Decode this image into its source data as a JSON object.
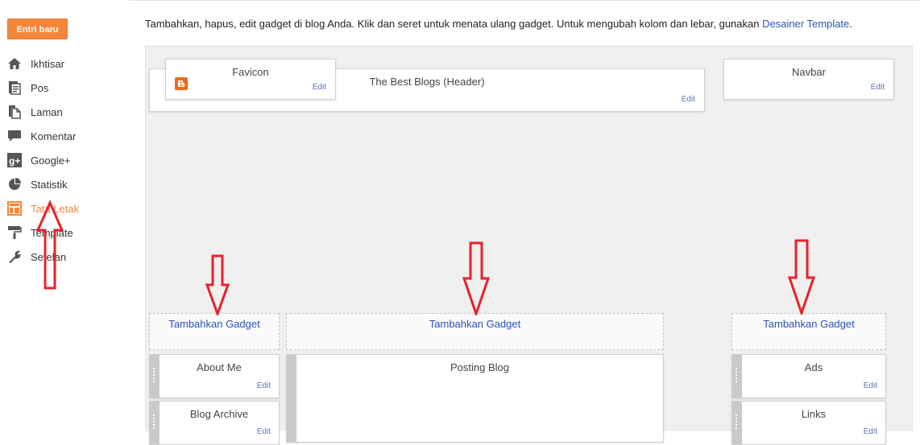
{
  "sidebar": {
    "new_post_label": "Entri baru",
    "items": [
      {
        "label": "Ikhtisar",
        "icon": "home-icon"
      },
      {
        "label": "Pos",
        "icon": "posts-icon"
      },
      {
        "label": "Laman",
        "icon": "pages-icon"
      },
      {
        "label": "Komentar",
        "icon": "comment-icon"
      },
      {
        "label": "Google+",
        "icon": "google-plus-icon"
      },
      {
        "label": "Statistik",
        "icon": "pie-chart-icon"
      },
      {
        "label": "Tata Letak",
        "icon": "layout-icon",
        "active": true
      },
      {
        "label": "Template",
        "icon": "paint-roller-icon"
      },
      {
        "label": "Setelan",
        "icon": "wrench-icon"
      }
    ]
  },
  "instructions": {
    "text": "Tambahkan, hapus, edit gadget di blog Anda. Klik dan seret untuk menata ulang gadget. Untuk mengubah kolom dan lebar, gunakan ",
    "link": "Desainer Template",
    "end": "."
  },
  "layout": {
    "favicon": {
      "title": "Favicon",
      "edit": "Edit"
    },
    "header": {
      "title": "The Best Blogs (Header)",
      "edit": "Edit"
    },
    "navbar": {
      "title": "Navbar",
      "edit": "Edit"
    },
    "add_gadget_left": "Tambahkan Gadget",
    "add_gadget_main": "Tambahkan Gadget",
    "add_gadget_right": "Tambahkan Gadget",
    "about_me": {
      "title": "About Me",
      "edit": "Edit"
    },
    "blog_archive": {
      "title": "Blog Archive",
      "edit": "Edit"
    },
    "posting_blog": {
      "title": "Posting Blog"
    },
    "ads": {
      "title": "Ads",
      "edit": "Edit"
    },
    "links": {
      "title": "Links",
      "edit": "Edit"
    }
  },
  "colors": {
    "accent": "#f4863b",
    "link": "#2a54b8",
    "annotation_arrow": "#e8212b"
  }
}
